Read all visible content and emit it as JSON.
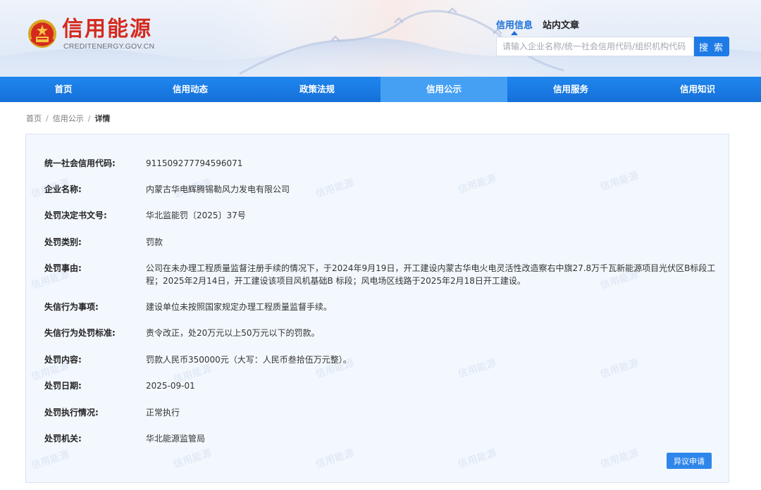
{
  "site": {
    "name_cn": "信用能源",
    "domain_text": "CREDITENERGY.GOV.CN"
  },
  "search": {
    "tabs": [
      "信用信息",
      "站内文章"
    ],
    "placeholder": "请输入企业名称/统一社会信用代码/组织机构代码",
    "button_label": "搜 索"
  },
  "nav": {
    "items": [
      "首页",
      "信用动态",
      "政策法规",
      "信用公示",
      "信用服务",
      "信用知识"
    ],
    "active": "信用公示"
  },
  "breadcrumb": {
    "items": [
      "首页",
      "信用公示",
      "详情"
    ]
  },
  "watermark_text": "信用能源",
  "detail": {
    "rows": [
      {
        "label": "统一社会信用代码:",
        "value": "911509277794596071"
      },
      {
        "label": "企业名称:",
        "value": "内蒙古华电辉腾锡勒风力发电有限公司"
      },
      {
        "label": "处罚决定书文号:",
        "value": "华北监能罚〔2025〕37号"
      },
      {
        "label": "处罚类别:",
        "value": "罚款"
      },
      {
        "label": "处罚事由:",
        "value": "公司在未办理工程质量监督注册手续的情况下，于2024年9月19日，开工建设内蒙古华电火电灵活性改造察右中旗27.8万千瓦新能源项目光伏区B标段工程；2025年2月14日，开工建设该项目风机基础B 标段；风电场区线路于2025年2月18日开工建设。"
      },
      {
        "label": "失信行为事项:",
        "value": "建设单位未按照国家规定办理工程质量监督手续。"
      },
      {
        "label": "失信行为处罚标准:",
        "value": "责令改正，处20万元以上50万元以下的罚款。"
      },
      {
        "label": "处罚内容:",
        "value": "罚款人民币350000元（大写：人民币叁拾伍万元整）。"
      },
      {
        "label": "处罚日期:",
        "value": "2025-09-01"
      },
      {
        "label": "处罚执行情况:",
        "value": "正常执行"
      },
      {
        "label": "处罚机关:",
        "value": "华北能源监管局"
      }
    ],
    "objection_button": "异议申请"
  },
  "colors": {
    "brand_red": "#d42a1e",
    "nav_blue": "#1f86ee",
    "nav_active": "#45a0f4",
    "search_button": "#1e7be6",
    "panel_bg": "#f3f8fe"
  }
}
